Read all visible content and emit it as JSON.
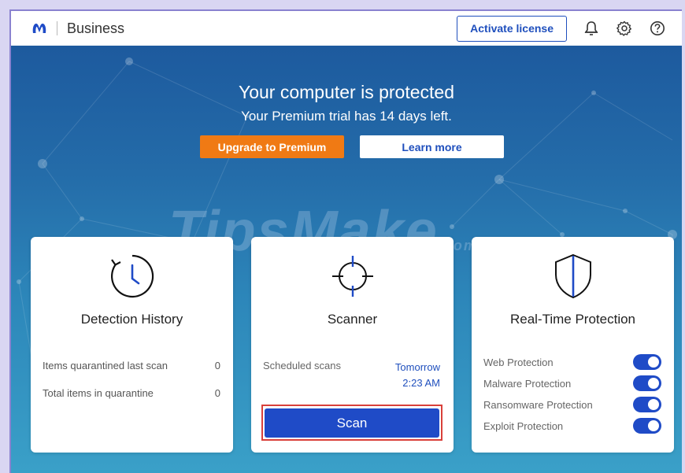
{
  "header": {
    "brand": "Business",
    "activate_label": "Activate license",
    "icons": [
      "bell-icon",
      "gear-icon",
      "help-icon"
    ],
    "accent": "#1f4fbd"
  },
  "hero": {
    "title": "Your computer is protected",
    "subtitle": "Your Premium trial has 14 days left.",
    "upgrade_label": "Upgrade to Premium",
    "learn_label": "Learn more",
    "watermark": "TipsMake",
    "watermark_suffix": ".com",
    "upgrade_color": "#f07a14"
  },
  "detection": {
    "title": "Detection History",
    "icon": "clock-history-icon",
    "stats": [
      {
        "label": "Items quarantined last scan",
        "value": "0"
      },
      {
        "label": "Total items in quarantine",
        "value": "0"
      }
    ]
  },
  "scanner": {
    "title": "Scanner",
    "icon": "crosshair-icon",
    "scheduled_label": "Scheduled scans",
    "scheduled_day": "Tomorrow",
    "scheduled_time": "2:23 AM",
    "scan_label": "Scan",
    "scan_color": "#1f4bc7"
  },
  "realtime": {
    "title": "Real-Time Protection",
    "icon": "shield-icon",
    "protections": [
      {
        "label": "Web Protection",
        "enabled": true
      },
      {
        "label": "Malware Protection",
        "enabled": true
      },
      {
        "label": "Ransomware Protection",
        "enabled": true
      },
      {
        "label": "Exploit Protection",
        "enabled": true
      }
    ]
  }
}
